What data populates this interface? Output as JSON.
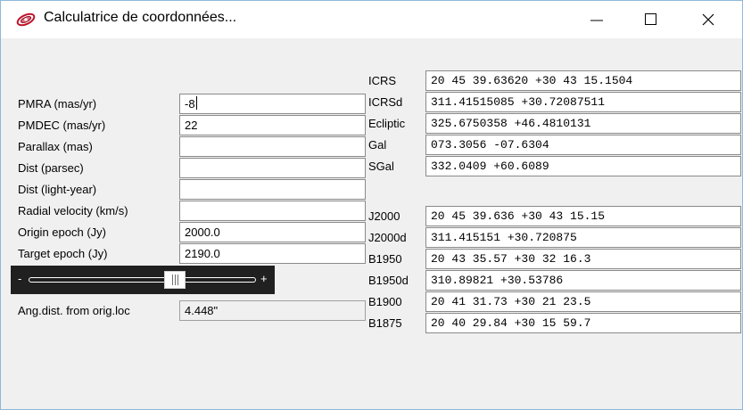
{
  "window": {
    "title": "Calculatrice de coordonnées..."
  },
  "left": {
    "pmra": {
      "label": "PMRA (mas/yr)",
      "value": "-8"
    },
    "pmdec": {
      "label": "PMDEC (mas/yr)",
      "value": "22"
    },
    "parallax": {
      "label": "Parallax (mas)",
      "value": ""
    },
    "dist_pc": {
      "label": "Dist (parsec)",
      "value": ""
    },
    "dist_ly": {
      "label": "Dist (light-year)",
      "value": ""
    },
    "radial_velocity": {
      "label": "Radial velocity (km/s)",
      "value": ""
    },
    "origin_epoch": {
      "label": "Origin epoch (Jy)",
      "value": "2000.0"
    },
    "target_epoch": {
      "label": "Target epoch (Jy)",
      "value": "2190.0"
    },
    "slider": {
      "minus": "-",
      "plus": "+"
    },
    "ang_dist": {
      "label": "Ang.dist. from orig.loc",
      "value": "4.448\""
    }
  },
  "right": {
    "icrs": {
      "label": "ICRS",
      "value": "20 45 39.63620 +30 43 15.1504"
    },
    "icrsd": {
      "label": "ICRSd",
      "value": "311.41515085 +30.72087511"
    },
    "ecliptic": {
      "label": "Ecliptic",
      "value": "325.6750358 +46.4810131"
    },
    "gal": {
      "label": "Gal",
      "value": "073.3056 -07.6304"
    },
    "sgal": {
      "label": "SGal",
      "value": "332.0409 +60.6089"
    },
    "j2000": {
      "label": "J2000",
      "value": "20 45 39.636 +30 43 15.15"
    },
    "j2000d": {
      "label": "J2000d",
      "value": "311.415151 +30.720875"
    },
    "b1950": {
      "label": "B1950",
      "value": "20 43 35.57 +30 32 16.3"
    },
    "b1950d": {
      "label": "B1950d",
      "value": "310.89821 +30.53786"
    },
    "b1900": {
      "label": "B1900",
      "value": "20 41 31.73 +30 21 23.5"
    },
    "b1875": {
      "label": "B1875",
      "value": "20 40 29.84 +30 15 59.7"
    }
  }
}
